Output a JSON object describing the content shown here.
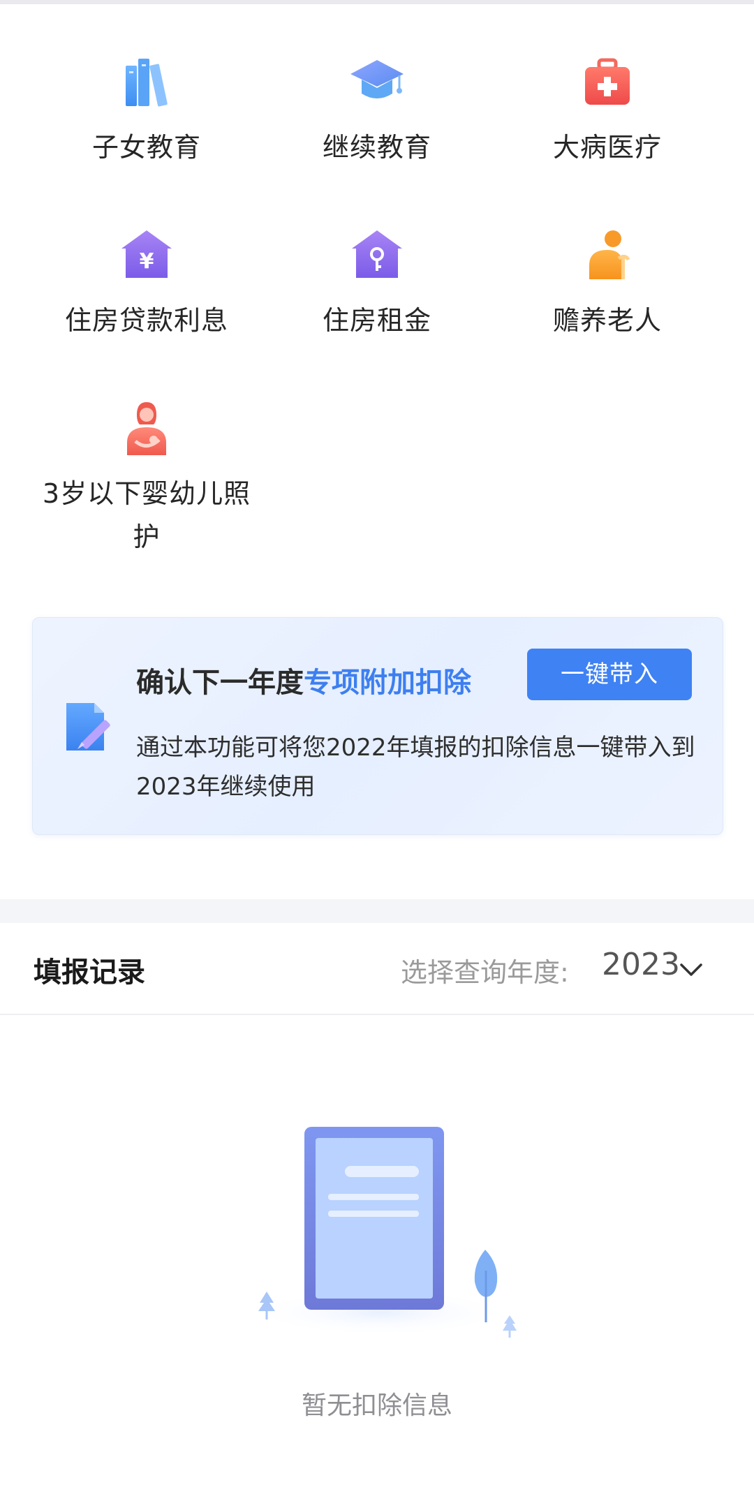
{
  "categories": [
    {
      "label": "子女教育",
      "icon": "books-icon"
    },
    {
      "label": "继续教育",
      "icon": "graduation-cap-icon"
    },
    {
      "label": "大病医疗",
      "icon": "medical-kit-icon"
    },
    {
      "label": "住房贷款利息",
      "icon": "house-yuan-icon"
    },
    {
      "label": "住房租金",
      "icon": "house-key-icon"
    },
    {
      "label": "赡养老人",
      "icon": "elderly-person-icon"
    },
    {
      "label": "3岁以下婴幼儿照护",
      "icon": "mother-infant-icon"
    }
  ],
  "card": {
    "title_plain": "确认下一年度",
    "title_highlight": "专项附加扣除",
    "button_label": "一键带入",
    "description": "通过本功能可将您2022年填报的扣除信息一键带入到2023年继续使用",
    "icon": "document-edit-icon"
  },
  "records": {
    "title": "填报记录",
    "year_select_label": "选择查询年度:",
    "year_value": "2023",
    "empty_text": "暂无扣除信息"
  },
  "colors": {
    "accent": "#3f82f3",
    "highlight_text": "#3d7ff0"
  }
}
